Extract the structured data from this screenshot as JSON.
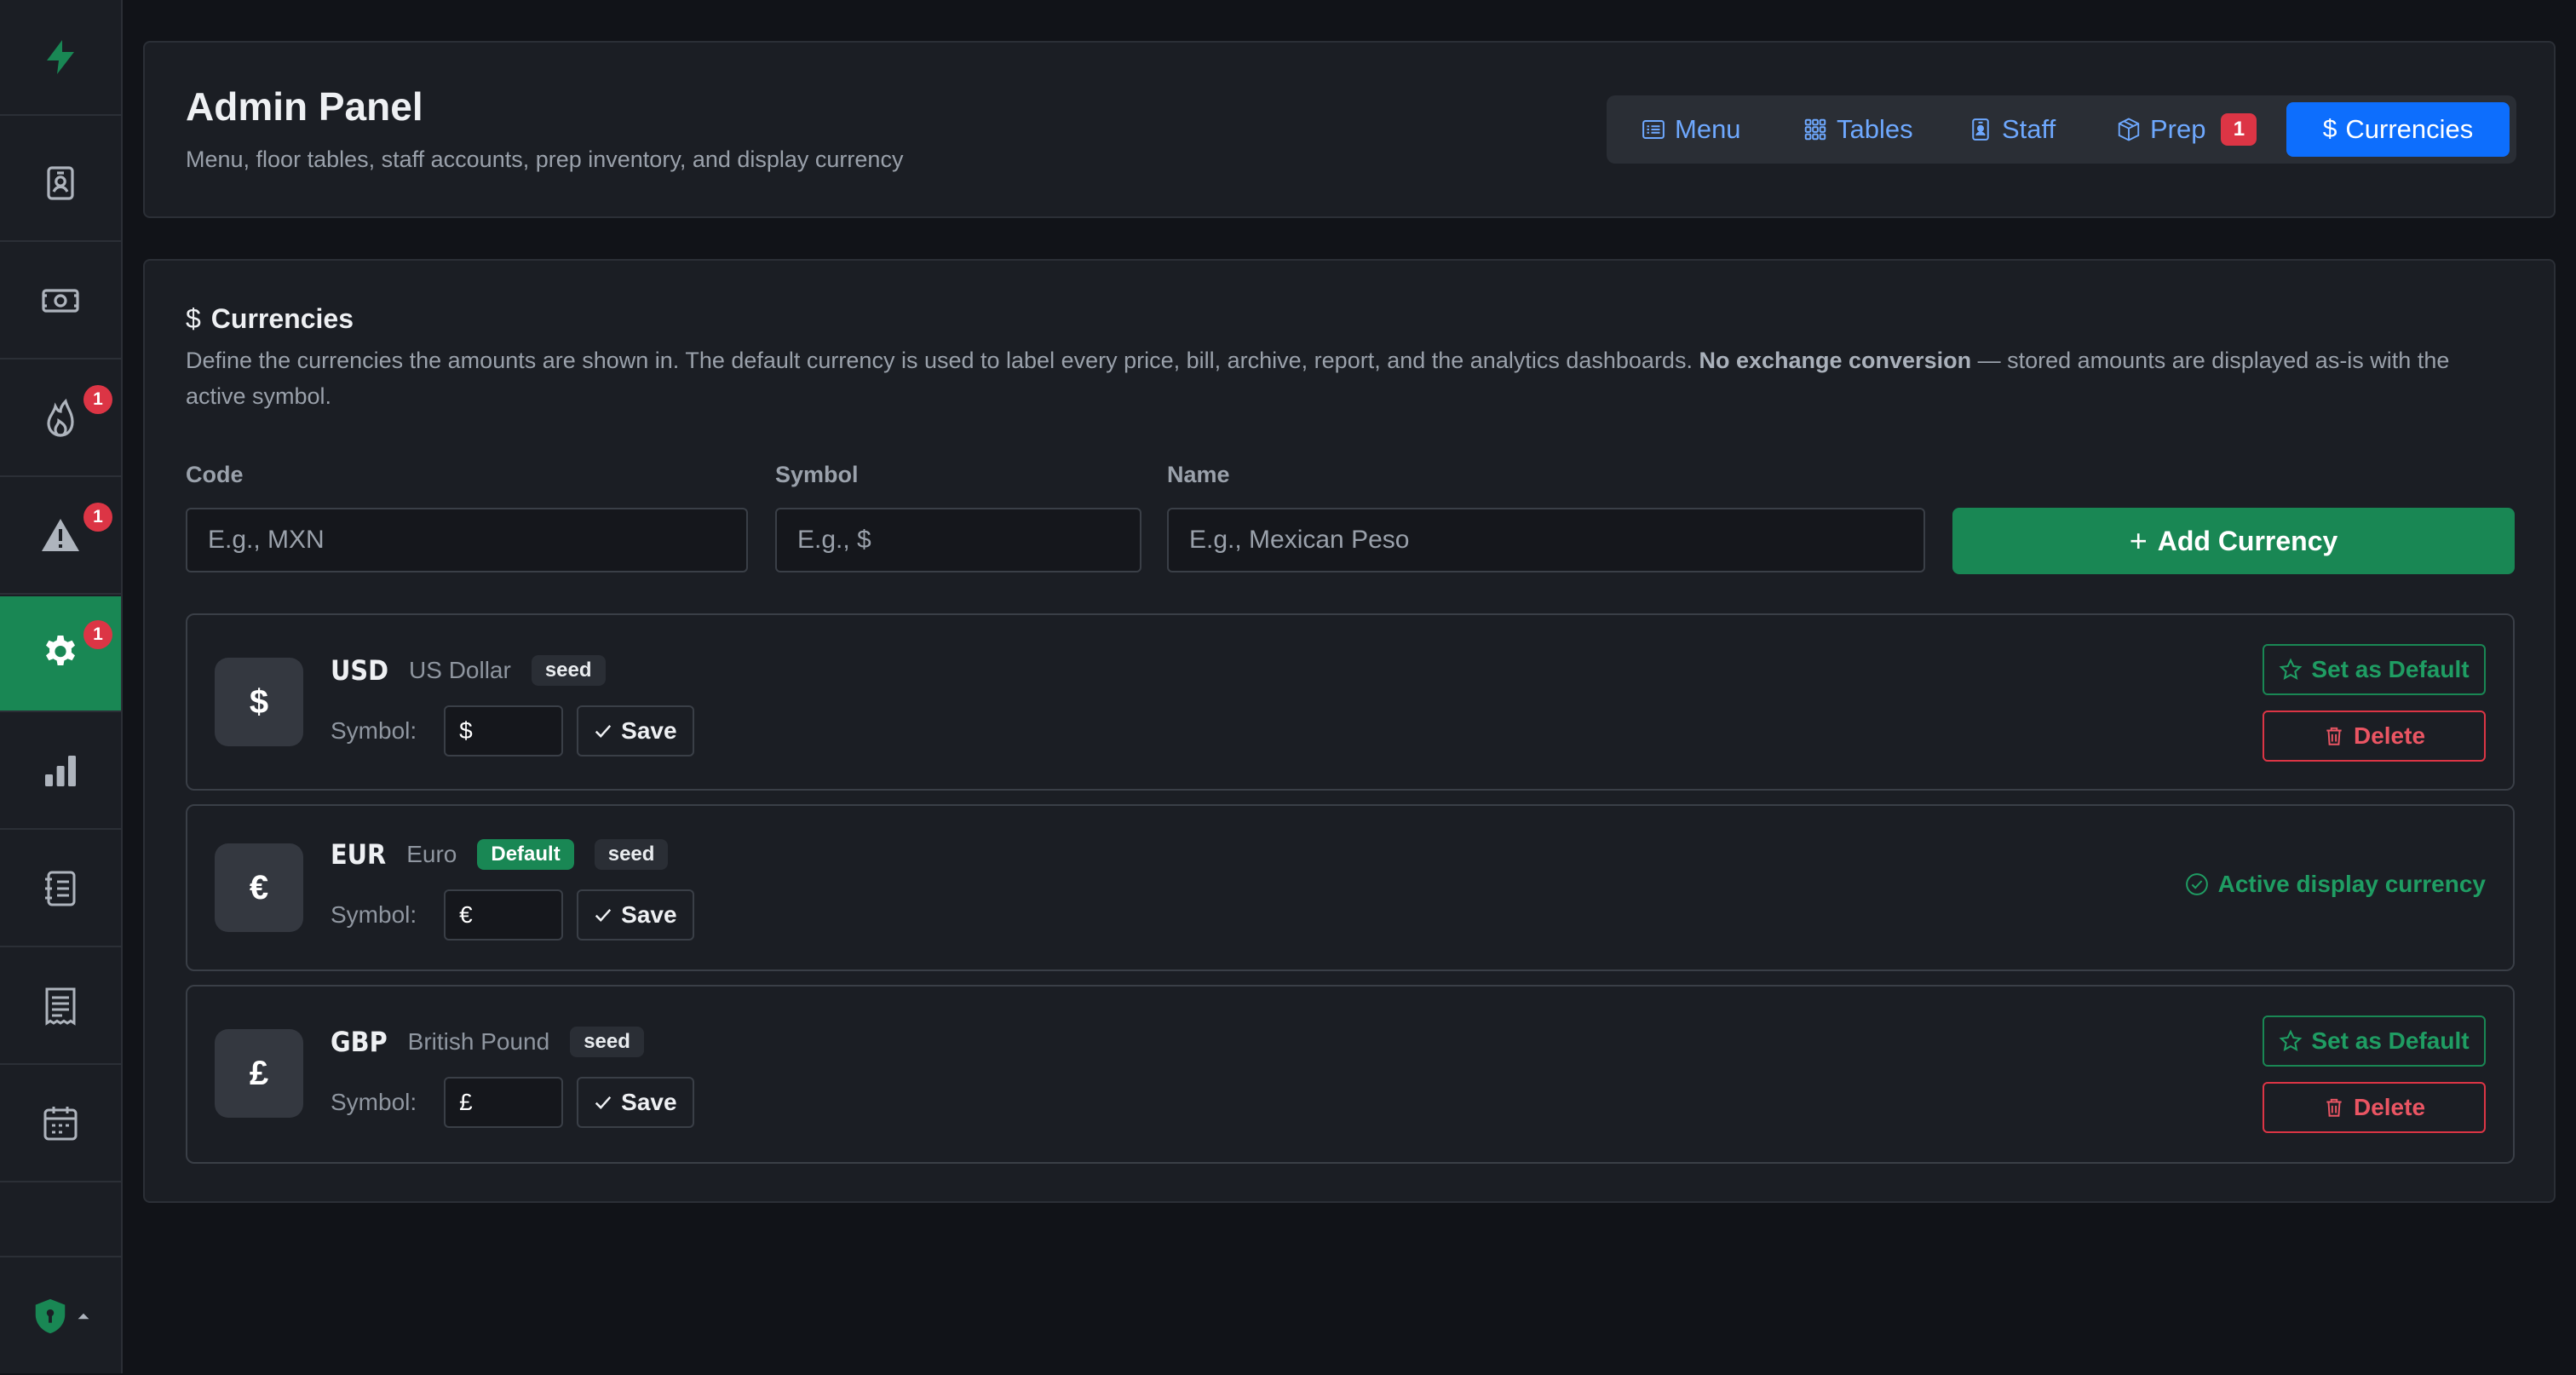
{
  "sidebar": {
    "items": [
      {
        "icon": "bolt-icon"
      },
      {
        "icon": "id-badge-icon"
      },
      {
        "icon": "cash-icon"
      },
      {
        "icon": "fire-icon",
        "badge": "1"
      },
      {
        "icon": "warning-icon",
        "badge": "1"
      },
      {
        "icon": "gear-icon",
        "badge": "1",
        "active": true
      },
      {
        "icon": "bar-chart-icon"
      },
      {
        "icon": "journal-list-icon"
      },
      {
        "icon": "receipt-icon"
      },
      {
        "icon": "calendar-icon"
      }
    ],
    "footer_icon": "shield-lock-icon"
  },
  "header": {
    "title": "Admin Panel",
    "subtitle": "Menu, floor tables, staff accounts, prep inventory, and display currency",
    "tabs": [
      {
        "label": "Menu",
        "icon": "list-icon"
      },
      {
        "label": "Tables",
        "icon": "grid-icon"
      },
      {
        "label": "Staff",
        "icon": "person-badge-icon"
      },
      {
        "label": "Prep",
        "icon": "box-icon",
        "badge": "1"
      },
      {
        "label": "Currencies",
        "icon": "dollar-icon",
        "active": true
      }
    ]
  },
  "currencies": {
    "title_icon": "$",
    "title": "Currencies",
    "description": "Define the currencies the amounts are shown in. The default currency is used to label every price, bill, archive, report, and the analytics dashboards.",
    "description_bold": "No exchange conversion",
    "description_tail": "— stored amounts are displayed as-is with the active symbol.",
    "form": {
      "code_label": "Code",
      "code_placeholder": "E.g., MXN",
      "symbol_label": "Symbol",
      "symbol_placeholder": "E.g., $",
      "name_label": "Name",
      "name_placeholder": "E.g., Mexican Peso",
      "add_button": "Add Currency",
      "add_icon": "+"
    },
    "symbol_label": "Symbol:",
    "save_label": "Save",
    "set_default_label": "Set as Default",
    "delete_label": "Delete",
    "active_label": "Active display currency",
    "items": [
      {
        "icon": "$",
        "code": "USD",
        "name": "US Dollar",
        "tags": [
          "seed"
        ],
        "symbol": "$",
        "is_default": false
      },
      {
        "icon": "€",
        "code": "EUR",
        "name": "Euro",
        "tags": [
          "Default",
          "seed"
        ],
        "symbol": "€",
        "is_default": true
      },
      {
        "icon": "£",
        "code": "GBP",
        "name": "British Pound",
        "tags": [
          "seed"
        ],
        "symbol": "£",
        "is_default": false
      }
    ]
  },
  "colors": {
    "background": "#111318",
    "card": "#1b1e24",
    "primary": "#0d6efd",
    "success": "#198754",
    "danger": "#dc3545",
    "link": "#6ea8fe"
  }
}
